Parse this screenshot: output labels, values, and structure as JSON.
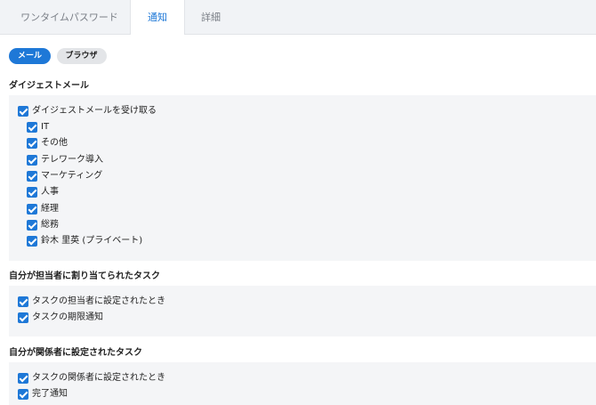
{
  "tabs": [
    {
      "label": "ワンタイムパスワード",
      "active": false
    },
    {
      "label": "通知",
      "active": true
    },
    {
      "label": "詳細",
      "active": false
    }
  ],
  "channels": [
    {
      "label": "メール",
      "active": true
    },
    {
      "label": "ブラウザ",
      "active": false
    }
  ],
  "sections": [
    {
      "title": "ダイジェストメール",
      "items": [
        {
          "label": "ダイジェストメールを受け取る",
          "checked": true
        },
        {
          "label": "IT",
          "checked": true
        },
        {
          "label": "その他",
          "checked": true
        },
        {
          "label": "テレワーク導入",
          "checked": true
        },
        {
          "label": "マーケティング",
          "checked": true
        },
        {
          "label": "人事",
          "checked": true
        },
        {
          "label": "経理",
          "checked": true
        },
        {
          "label": "総務",
          "checked": true
        },
        {
          "label": "鈴木 里英 (プライベート)",
          "checked": true
        }
      ]
    },
    {
      "title": "自分が担当者に割り当てられたタスク",
      "items": [
        {
          "label": "タスクの担当者に設定されたとき",
          "checked": true
        },
        {
          "label": "タスクの期限通知",
          "checked": true
        }
      ]
    },
    {
      "title": "自分が関係者に設定されたタスク",
      "items": [
        {
          "label": "タスクの関係者に設定されたとき",
          "checked": true
        },
        {
          "label": "完了通知",
          "checked": true
        }
      ]
    }
  ],
  "colors": {
    "accent": "#1e78d7",
    "group_bg": "#f4f5f7"
  }
}
